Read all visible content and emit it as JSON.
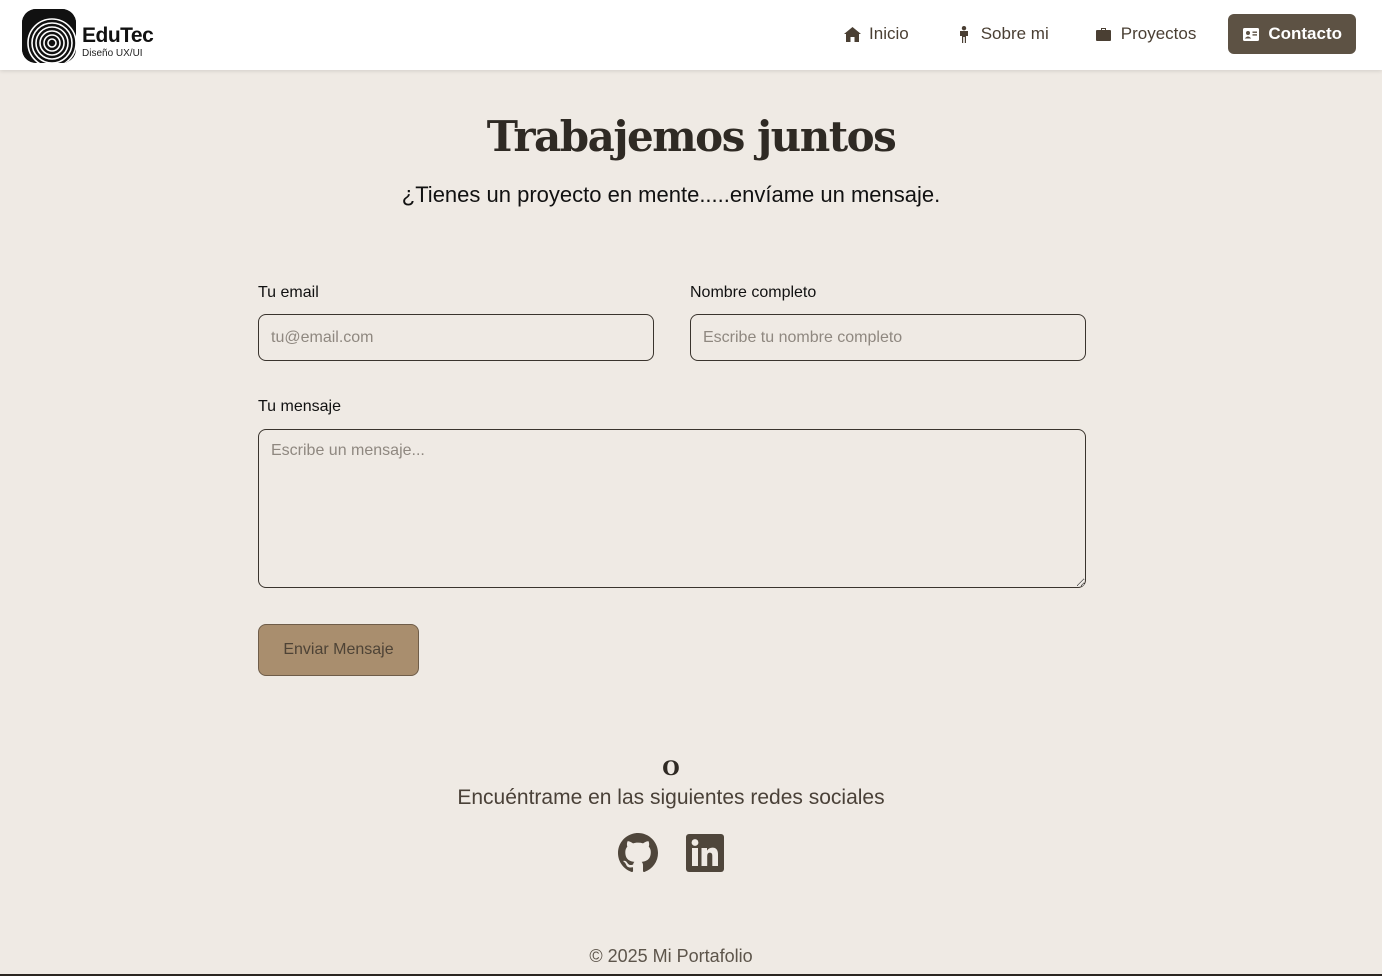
{
  "brand": {
    "name": "EduTec",
    "tagline": "Diseño UX/UI"
  },
  "nav": {
    "items": [
      {
        "label": "Inicio",
        "icon": "home-icon"
      },
      {
        "label": "Sobre mi",
        "icon": "person-icon"
      },
      {
        "label": "Proyectos",
        "icon": "briefcase-icon"
      },
      {
        "label": "Contacto",
        "icon": "contact-card-icon",
        "active": true
      }
    ]
  },
  "contact": {
    "title": "Trabajemos juntos",
    "subtitle": "¿Tienes un proyecto en mente.....envíame un mensaje.",
    "email_label": "Tu email",
    "email_placeholder": "tu@email.com",
    "name_label": "Nombre completo",
    "name_placeholder": "Escribe tu nombre completo",
    "message_label": "Tu mensaje",
    "message_placeholder": "Escribe un mensaje...",
    "send_label": "Enviar Mensaje"
  },
  "social": {
    "or": "O",
    "text": "Encuéntrame en las siguientes redes sociales",
    "links": [
      {
        "name": "GitHub",
        "icon": "github-icon"
      },
      {
        "name": "LinkedIn",
        "icon": "linkedin-icon"
      }
    ]
  },
  "footer": {
    "copyright": "© 2025 Mi Portafolio"
  },
  "colors": {
    "background": "#efeae4",
    "nav_active": "#5d5244",
    "button": "#a98e6e",
    "text_dark": "#2f2a24"
  }
}
